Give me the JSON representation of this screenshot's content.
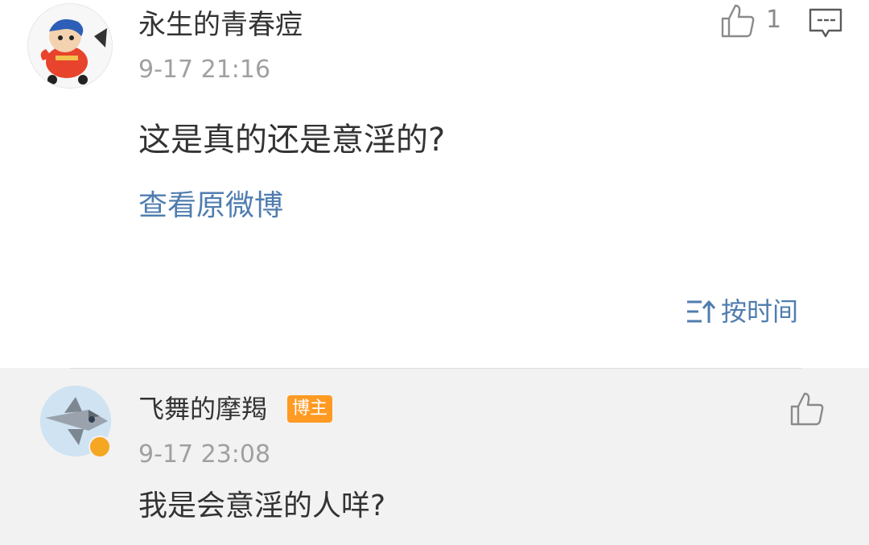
{
  "comment": {
    "username": "永生的青春痘",
    "time": "9-17 21:16",
    "text": "这是真的还是意淫的?",
    "view_original": "查看原微博",
    "like_count": "1"
  },
  "sort": {
    "label": "按时间"
  },
  "reply": {
    "username": "飞舞的摩羯",
    "badge": "博主",
    "time": "9-17 23:08",
    "text": "我是会意淫的人咩?"
  },
  "icons": {
    "like": "thumbs-up-icon",
    "reply": "comment-bubble-icon",
    "sort": "sort-time-icon",
    "verified": "verified-badge-icon"
  },
  "colors": {
    "link": "#507daf",
    "host_badge": "#ff9a23",
    "verified": "#f5a623",
    "reply_bg": "#f2f2f2"
  }
}
